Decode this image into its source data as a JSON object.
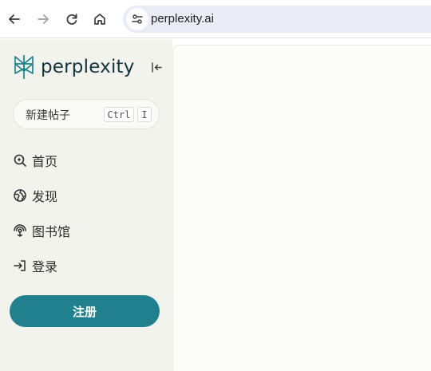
{
  "browser": {
    "url": "perplexity.ai"
  },
  "sidebar": {
    "brand": "perplexity",
    "new_thread": {
      "label": "新建帖子",
      "shortcut_key1": "Ctrl",
      "shortcut_key2": "I"
    },
    "items": [
      {
        "label": "首页",
        "icon": "search-icon"
      },
      {
        "label": "发现",
        "icon": "globe-icon"
      },
      {
        "label": "图书馆",
        "icon": "library-icon"
      },
      {
        "label": "登录",
        "icon": "sign-in-icon"
      }
    ],
    "signup_label": "注册"
  },
  "colors": {
    "accent": "#20808d",
    "sidebar_bg": "#f3f3ee",
    "main_bg": "#fcfcf9",
    "omnibox_bg": "#e9ebf5",
    "brand_text": "#13343b"
  }
}
